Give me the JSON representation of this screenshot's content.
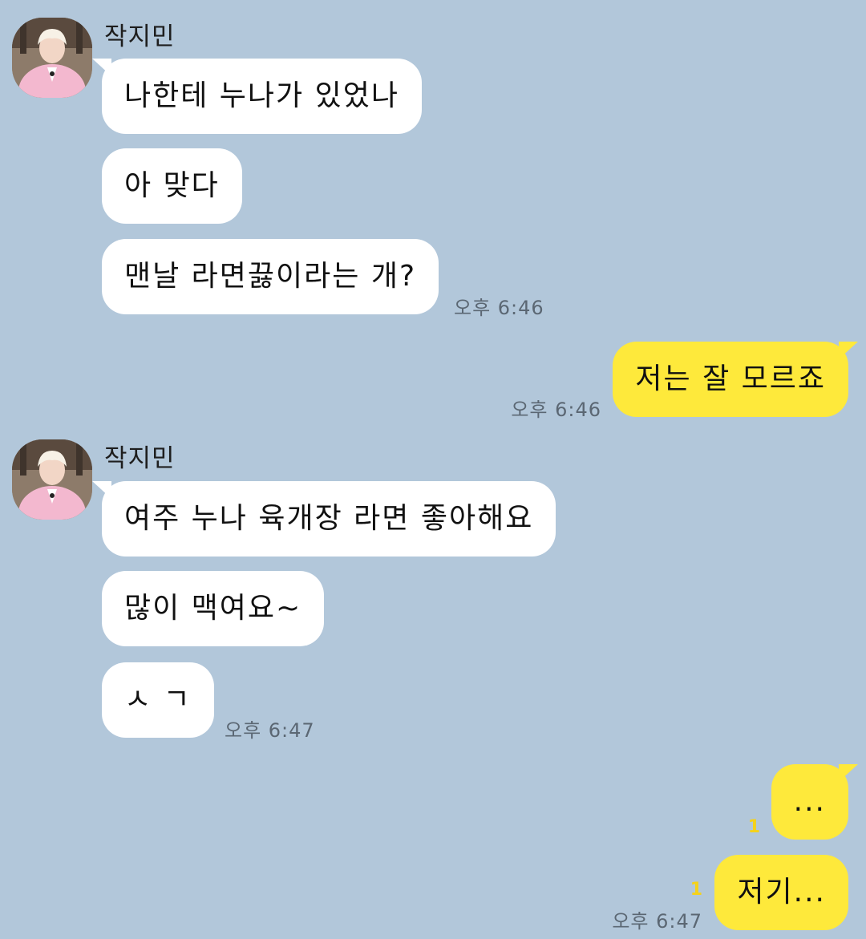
{
  "groups": [
    {
      "sender": "작지민",
      "messages": [
        "나한테 누나가 있었나",
        "아 맞다",
        "맨날 라면끓이라는 개?"
      ],
      "time": "오후 6:46"
    },
    {
      "outgoing": [
        "저는 잘 모르죠"
      ],
      "time": "오후 6:46"
    },
    {
      "sender": "작지민",
      "messages": [
        "여주 누나 육개장 라면 좋아해요",
        "많이 맥여요~",
        "ㅅ ㄱ"
      ],
      "time": "오후 6:47"
    },
    {
      "outgoing": [
        "...",
        "저기..."
      ],
      "unread": [
        "1",
        "1"
      ],
      "time": "오후 6:47"
    }
  ],
  "colors": {
    "background": "#b2c7da",
    "incoming_bubble": "#ffffff",
    "outgoing_bubble": "#fee93b",
    "unread": "#f5d21a"
  }
}
